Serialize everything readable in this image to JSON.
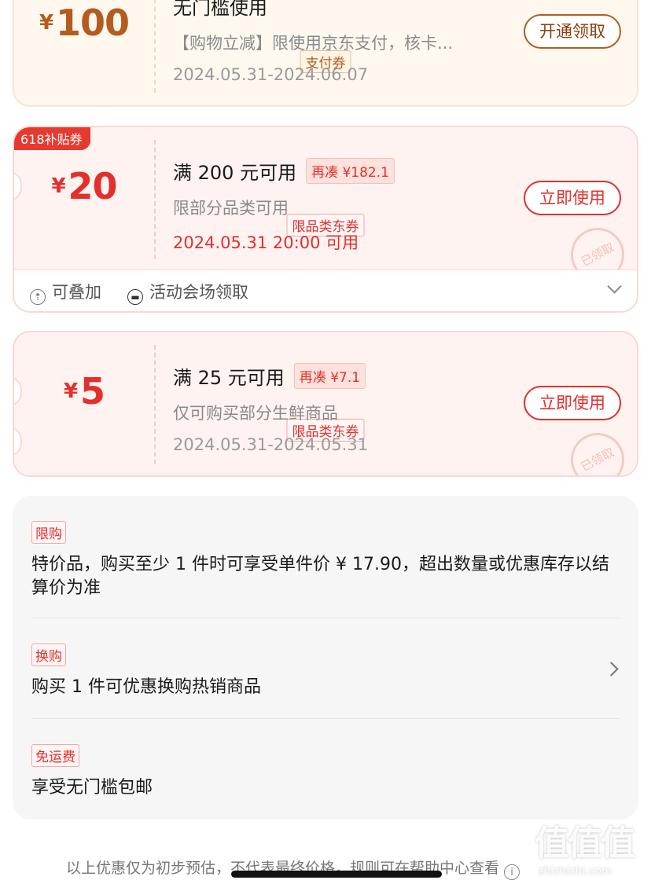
{
  "coupon_pay": {
    "currency": "¥",
    "amount": "100",
    "tag": "支付券",
    "title": "无门槛使用",
    "desc": "【购物立减】限使用京东支付，核卡...",
    "date": "2024.05.31-2024.06.07",
    "button": "开通领取"
  },
  "coupon_618": {
    "badge": "618补贴券",
    "currency": "¥",
    "amount": "20",
    "tag": "限品类东券",
    "title": "满 200 元可用",
    "pill": "再凑 ¥182.1",
    "desc": "限部分品类可用",
    "date": "2024.05.31 20:00 可用",
    "button": "立即使用",
    "stamp": "已领取",
    "footer": {
      "stackable": "可叠加",
      "venue": "活动会场领取"
    }
  },
  "coupon_fresh": {
    "currency": "¥",
    "amount": "5",
    "tag": "限品类东券",
    "title": "满 25 元可用",
    "pill": "再凑 ¥7.1",
    "desc": "仅可购买部分生鲜商品",
    "date": "2024.05.31-2024.05.31",
    "button": "立即使用",
    "stamp": "已领取"
  },
  "promotions": [
    {
      "tag": "限购",
      "text": "特价品，购买至少 1 件时可享受单件价 ¥ 17.90，超出数量或优惠库存以结算价为准"
    },
    {
      "tag": "换购",
      "text": "购买 1 件可优惠换购热销商品"
    },
    {
      "tag": "免运费",
      "text": "享受无门槛包邮"
    }
  ],
  "disclaimer": "以上优惠仅为初步预估，不代表最终价格，规则可在帮助中心查看",
  "watermark": {
    "logo": "值值值",
    "site": "zhizhizhi.com"
  },
  "colors": {
    "brand_red": "#e2302c",
    "pay_brown": "#b45c1f",
    "badge_red": "#e8392e"
  }
}
